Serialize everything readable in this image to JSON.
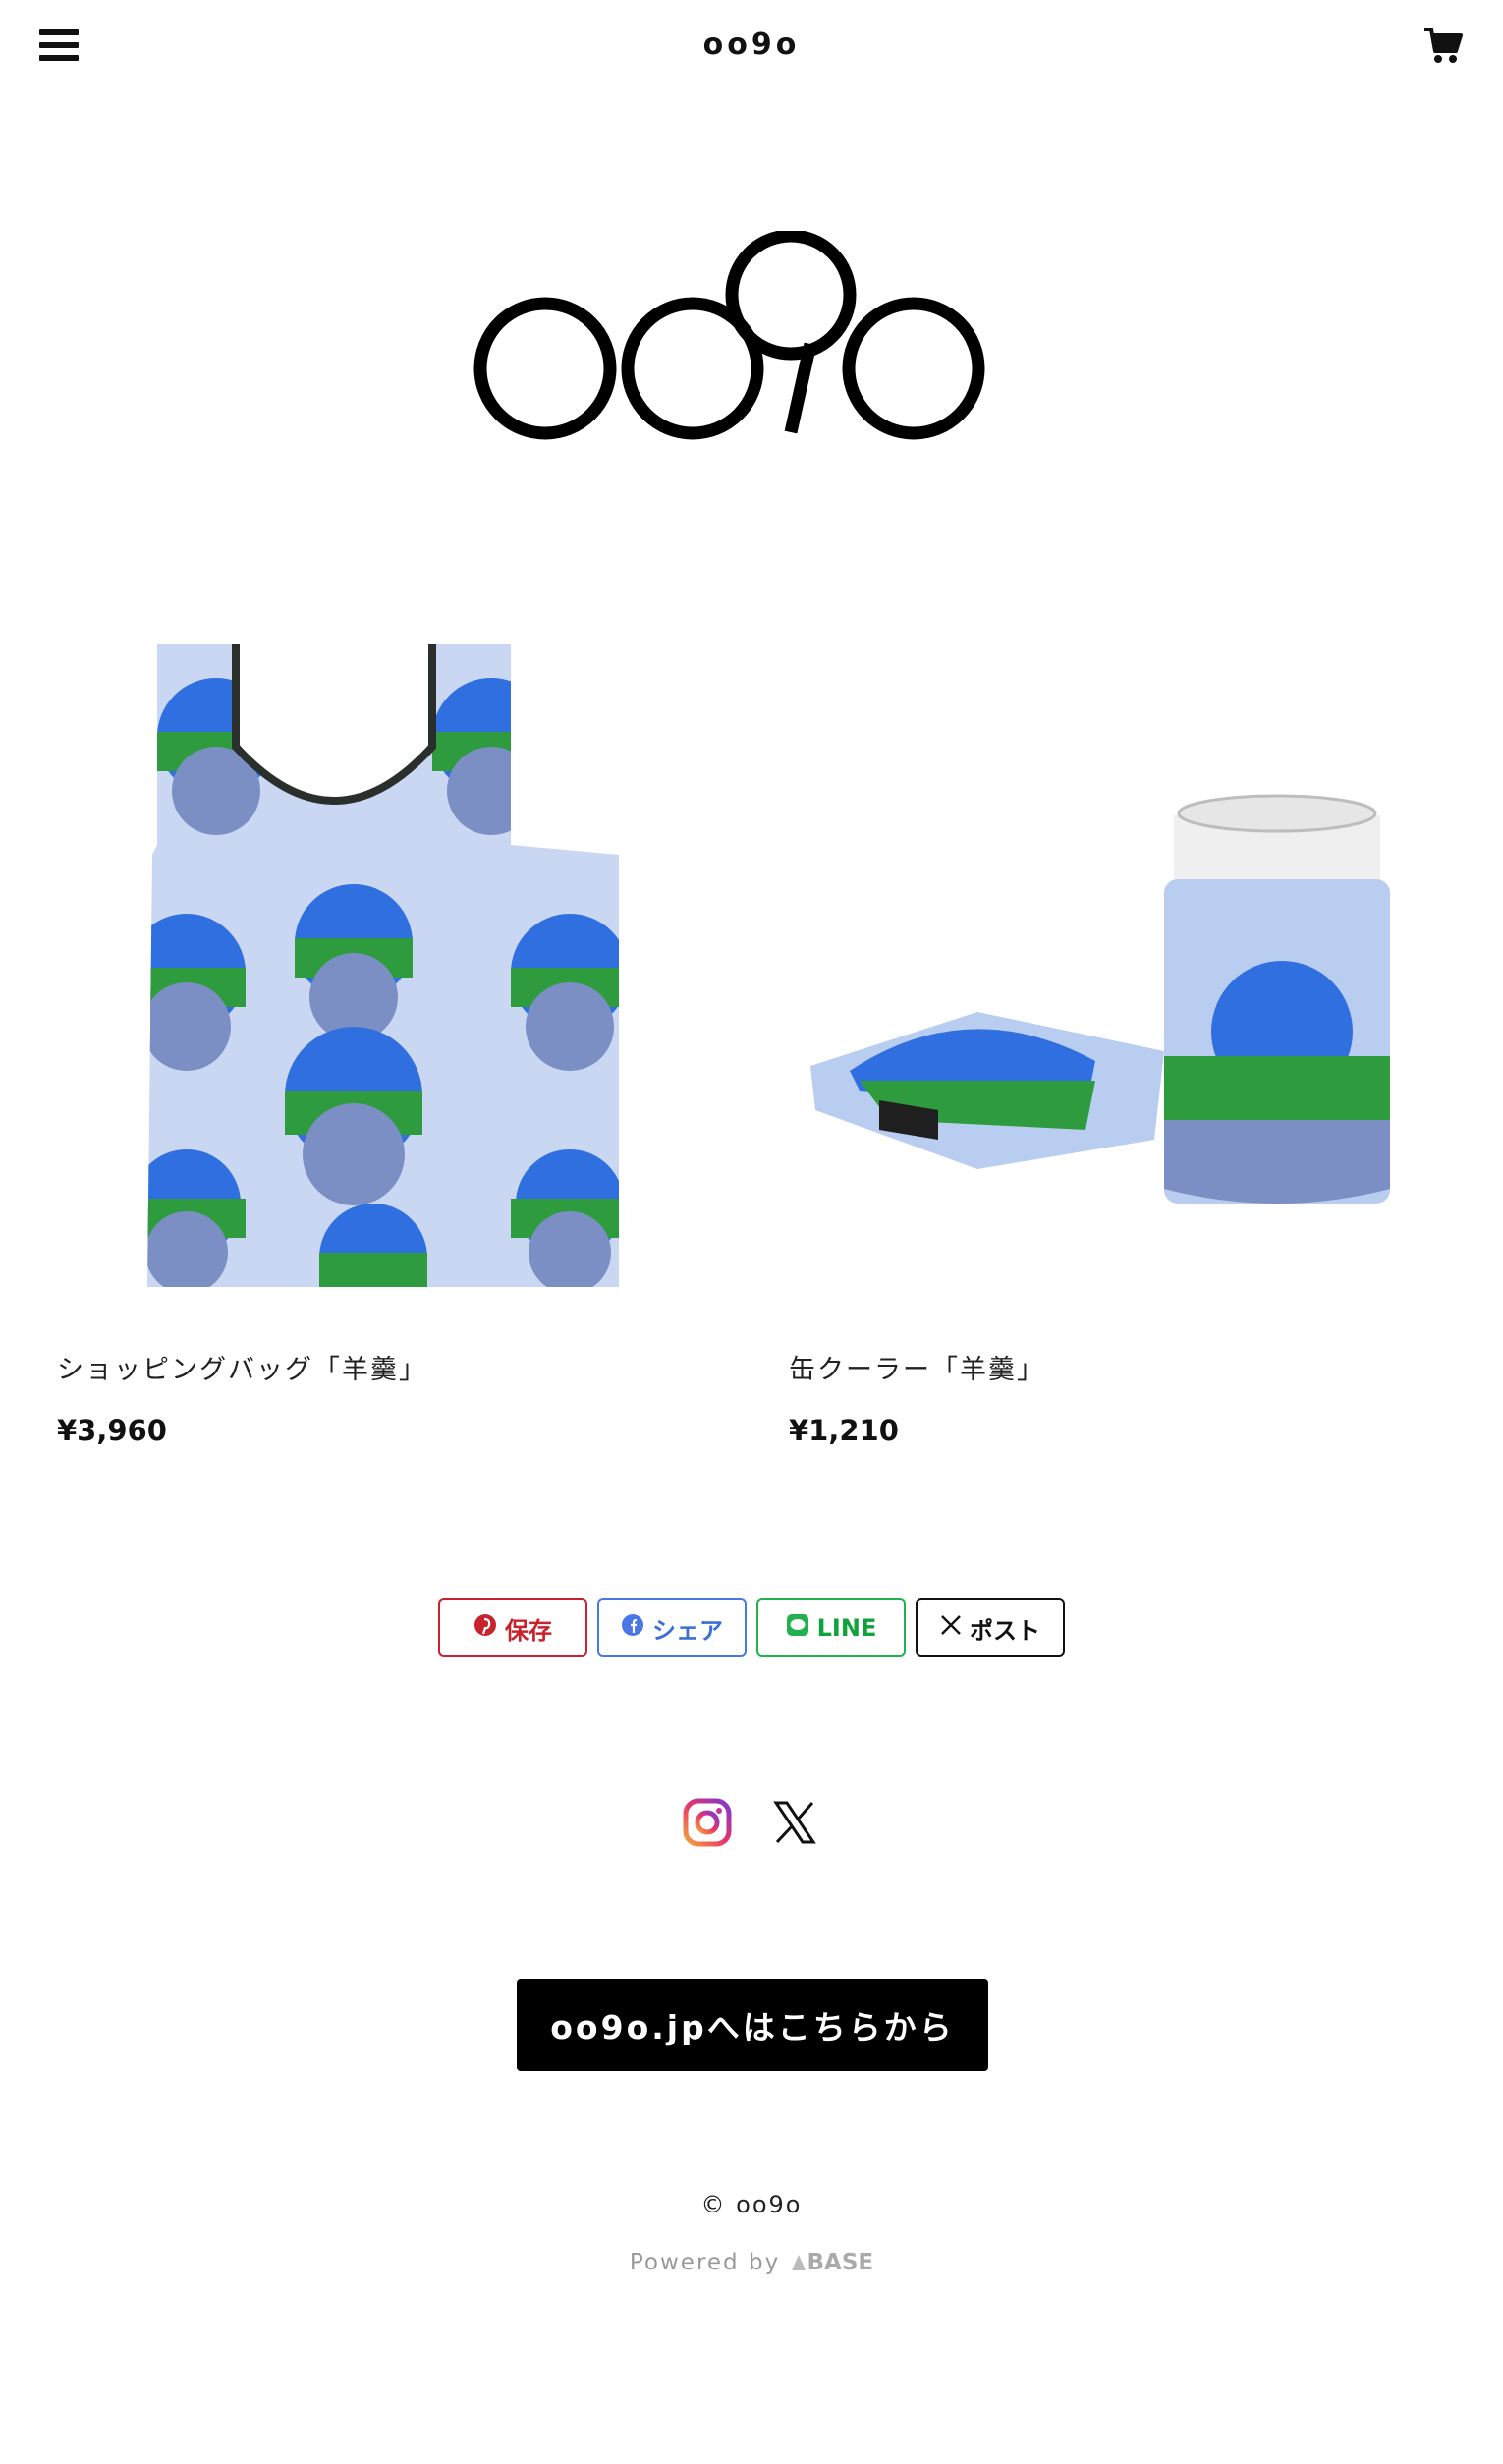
{
  "header": {
    "site_title": "oo9o",
    "menu_icon": "hamburger-menu-icon",
    "cart_icon": "shopping-cart-icon"
  },
  "brand": {
    "logo_text": "oo9o"
  },
  "products": [
    {
      "name": "ショッピングバッグ「羊羹」",
      "price": "¥3,960"
    },
    {
      "name": "缶クーラー「羊羹」",
      "price": "¥1,210"
    }
  ],
  "share": {
    "pinterest": "保存",
    "facebook": "シェア",
    "line": "LINE",
    "x": "ポスト"
  },
  "social": {
    "instagram_icon": "instagram-icon",
    "x_icon": "x-icon"
  },
  "cta": {
    "label": "oo9o.jpへはこちらから"
  },
  "footer": {
    "copyright": "© oo9o",
    "powered_prefix": "Powered by",
    "powered_brand": "BASE"
  },
  "colors": {
    "pinterest": "#c8232c",
    "facebook": "#4a77e6",
    "line": "#22b14c",
    "cta_bg": "#000000"
  }
}
